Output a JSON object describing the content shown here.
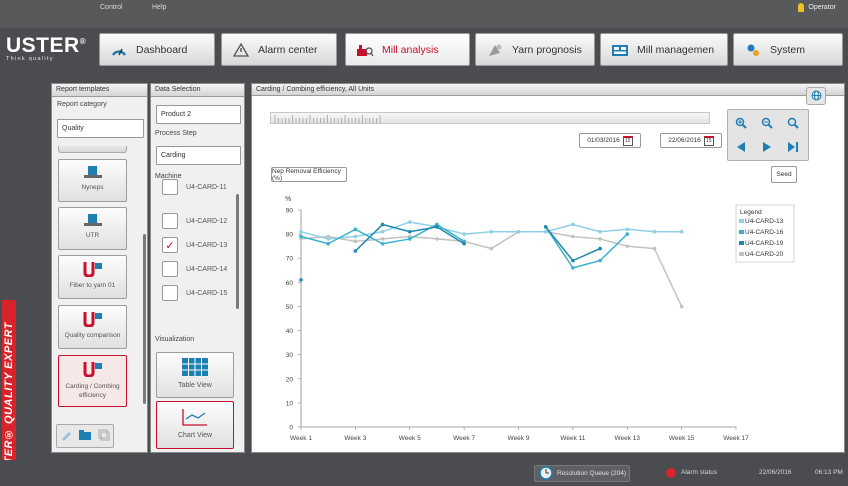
{
  "topbar": {
    "menu_control": "Control",
    "menu_help": "Help",
    "operator": "Operator"
  },
  "brand": {
    "name": "USTER",
    "mark": "®",
    "tagline": "Think quality",
    "vertical": "USTER® QUALITY EXPERT"
  },
  "nav": [
    {
      "label": "Dashboard",
      "icon": "dashboard-icon"
    },
    {
      "label": "Alarm center",
      "icon": "alarm-icon"
    },
    {
      "label": "Mill analysis",
      "icon": "mill-analysis-icon",
      "active": true
    },
    {
      "label": "Yarn prognosis",
      "icon": "yarn-icon"
    },
    {
      "label": "Mill managemen",
      "icon": "mill-management-icon"
    },
    {
      "label": "System",
      "icon": "system-icon"
    }
  ],
  "report_templates": {
    "title": "Report templates",
    "category_label": "Report category",
    "category_value": "Quality",
    "items": [
      "Nyneps",
      "UTR",
      "Fiber to yarn 01",
      "Quality comparison",
      "Carding / Combing efficiency"
    ]
  },
  "data_selection": {
    "title": "Data Selection",
    "product": "Product 2",
    "process_step_label": "Process Step",
    "process_step": "Carding",
    "machine_label": "Machine",
    "machines": [
      {
        "name": "U4-CARD-11",
        "checked": false
      },
      {
        "name": "U4-CARD-12",
        "checked": false
      },
      {
        "name": "U4-CARD-13",
        "checked": true
      },
      {
        "name": "U4-CARD-14",
        "checked": false
      },
      {
        "name": "U4-CARD-15",
        "checked": false
      }
    ],
    "visualization_label": "Visualization",
    "table_view": "Table View",
    "chart_view": "Chart View"
  },
  "chart_panel": {
    "title": "Carding / Combing efficiency, All Units",
    "date_from": "01/03/2016",
    "date_to": "22/06/2016",
    "calendar_day": "15",
    "metric_button": "Nep Removal Efficiency (%)",
    "seed_button": "Seed"
  },
  "chart_data": {
    "type": "line",
    "ylabel": "%",
    "ylim": [
      0,
      90
    ],
    "yticks": [
      0,
      10,
      20,
      30,
      40,
      50,
      60,
      70,
      80,
      90
    ],
    "xticks": [
      "Week 1",
      "Week 3",
      "Week 5",
      "Week 7",
      "Week 9",
      "Week 11",
      "Week 13",
      "Week 15",
      "Week 17"
    ],
    "xlim": [
      1,
      17
    ],
    "legend_title": "Legend",
    "series": [
      {
        "name": "U4-CARD-13",
        "color": "#8fd0e6",
        "points": [
          [
            1,
            81
          ],
          [
            2,
            78
          ],
          [
            3,
            79
          ],
          [
            4,
            81
          ],
          [
            5,
            85
          ],
          [
            6,
            83
          ],
          [
            7,
            80
          ],
          [
            8,
            81
          ],
          [
            9,
            81
          ],
          [
            10,
            81
          ],
          [
            11,
            84
          ],
          [
            12,
            81
          ],
          [
            13,
            82
          ],
          [
            14,
            81
          ],
          [
            15,
            81
          ]
        ]
      },
      {
        "name": "U4-CARD-16",
        "color": "#39b2cf",
        "points": [
          [
            1,
            79
          ],
          [
            2,
            76
          ],
          [
            3,
            82
          ],
          [
            4,
            76
          ],
          [
            5,
            78
          ],
          [
            6,
            84
          ],
          [
            7,
            77
          ],
          [
            10,
            83
          ],
          [
            11,
            66
          ],
          [
            12,
            69
          ],
          [
            13,
            80
          ]
        ]
      },
      {
        "name": "U4-CARD-19",
        "color": "#1e89ae",
        "points": [
          [
            1,
            61
          ],
          [
            3,
            73
          ],
          [
            4,
            84
          ],
          [
            5,
            81
          ],
          [
            6,
            83
          ],
          [
            7,
            76
          ],
          [
            10,
            83
          ],
          [
            11,
            69
          ],
          [
            12,
            74
          ]
        ]
      },
      {
        "name": "U4-CARD-20",
        "color": "#c2c2c2",
        "points": [
          [
            1,
            78
          ],
          [
            2,
            79
          ],
          [
            3,
            77
          ],
          [
            4,
            78
          ],
          [
            5,
            79
          ],
          [
            6,
            78
          ],
          [
            7,
            77
          ],
          [
            8,
            74
          ],
          [
            9,
            81
          ],
          [
            10,
            81
          ],
          [
            11,
            79
          ],
          [
            12,
            78
          ],
          [
            13,
            75
          ],
          [
            14,
            74
          ],
          [
            15,
            50
          ]
        ]
      }
    ]
  },
  "status": {
    "queue": "Resolution Queue (204)",
    "alarm": "Alarm status",
    "date": "22/06/2016",
    "time": "06:13 PM"
  }
}
